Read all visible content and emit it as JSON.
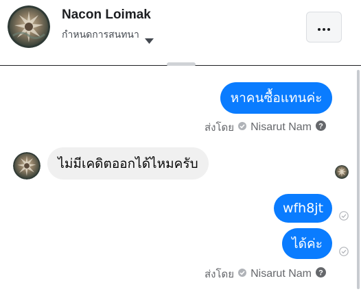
{
  "header": {
    "contact_name": "Nacon Loimak",
    "subtitle": "กำหนดการสนทนา",
    "caret_icon": "caret-down-icon",
    "more_icon": "more-horizontal-icon"
  },
  "conversation": {
    "messages": [
      {
        "direction": "outgoing",
        "text": "หาคนซื้อแทนค่ะ"
      },
      {
        "direction": "incoming",
        "text": "ไม่มีเคดิตออกได้ไหมครับ"
      },
      {
        "direction": "outgoing",
        "text": "wfh8jt",
        "status": "sent"
      },
      {
        "direction": "outgoing",
        "text": "ได้ค่ะ",
        "status": "sent"
      }
    ],
    "sent_by": {
      "label": "ส่งโดย",
      "name": "Nisarut Nam"
    }
  },
  "colors": {
    "outgoing_bubble": "#0a7cff",
    "incoming_bubble": "#f0f0f0",
    "secondary_text": "#65676b"
  }
}
